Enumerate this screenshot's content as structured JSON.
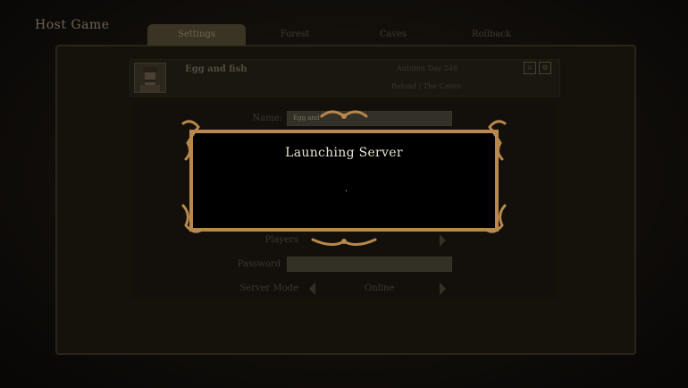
{
  "page_title": "Host Game",
  "tabs": [
    {
      "label": "Settings",
      "active": true
    },
    {
      "label": "Forest",
      "active": false
    },
    {
      "label": "Caves",
      "active": false
    },
    {
      "label": "Rollback",
      "active": false
    }
  ],
  "slot": {
    "name": "Egg and fish",
    "day": "Autumn Day 248",
    "world": "Reload / The Caves",
    "icons": [
      "pvp-icon",
      "mod-icon"
    ]
  },
  "form": {
    "name_label": "Name:",
    "name_value": "Egg and",
    "players_label": "Players",
    "password_label": "Password",
    "server_mode_label": "Server Mode",
    "server_mode_value": "Online"
  },
  "dialog": {
    "title": "Launching Server",
    "progress": "."
  },
  "colors": {
    "frame_gold": "#b9884c",
    "background": "#0c0a07"
  }
}
